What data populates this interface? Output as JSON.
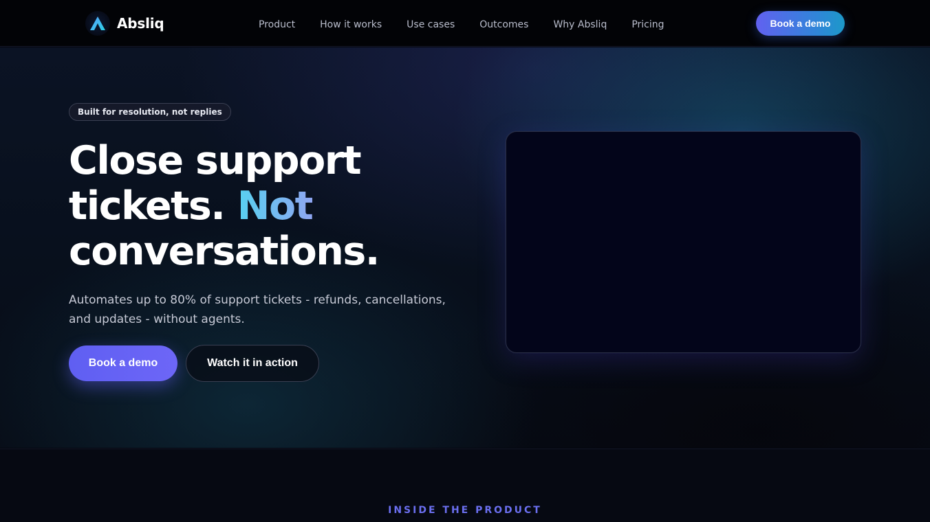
{
  "nav": {
    "brand_name": "Absliq",
    "links": [
      "Product",
      "How it works",
      "Use cases",
      "Outcomes",
      "Why Absliq",
      "Pricing"
    ],
    "cta_label": "Book a demo"
  },
  "hero": {
    "badge": "Built for resolution, not replies",
    "headline_line1": "Close support",
    "headline_line2_pre": "tickets.",
    "headline_line2_accent": "Not",
    "headline_line3": "conversations.",
    "subcopy": "Automates up to 80% of support tickets - refunds, cancellations, and updates - without agents.",
    "primary_cta": "Book a demo",
    "secondary_cta": "Watch it in action"
  },
  "product_section": {
    "eyebrow": "INSIDE THE PRODUCT"
  },
  "colors": {
    "accent_indigo": "#5f5ff2",
    "accent_cyan": "#57d1f0",
    "background": "#03050d"
  },
  "icons": {
    "brand_logo": "absliq-logo-icon"
  }
}
